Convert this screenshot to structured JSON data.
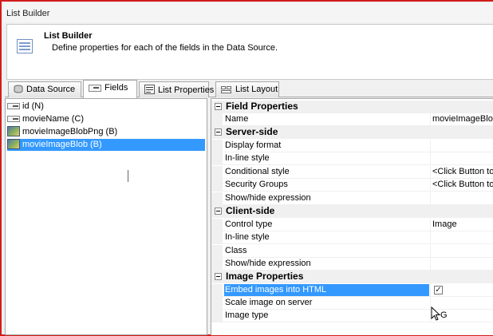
{
  "window": {
    "title": "List Builder"
  },
  "header": {
    "title": "List Builder",
    "description": "Define properties for each of the fields in the Data Source."
  },
  "tabs": [
    {
      "label": "Data Source",
      "icon": "database-icon"
    },
    {
      "label": "Fields",
      "icon": "field-icon",
      "active": true
    },
    {
      "label": "List Properties",
      "icon": "properties-icon"
    },
    {
      "label": "List Layout",
      "icon": "layout-icon"
    }
  ],
  "fields": [
    {
      "label": "id (N)",
      "icon": "text-field-icon"
    },
    {
      "label": "movieName (C)",
      "icon": "text-field-icon"
    },
    {
      "label": "movieImageBlobPng (B)",
      "icon": "image-field-icon"
    },
    {
      "label": "movieImageBlob (B)",
      "icon": "image-field-icon",
      "selected": true
    }
  ],
  "properties": {
    "field_properties": {
      "label": "Field Properties",
      "rows": [
        {
          "name": "Name",
          "value": "movieImageBlob"
        }
      ]
    },
    "server_side": {
      "label": "Server-side",
      "rows": [
        {
          "name": "Display format",
          "value": ""
        },
        {
          "name": "In-line style",
          "value": ""
        },
        {
          "name": "Conditional style",
          "value": "<Click Button to"
        },
        {
          "name": "Security Groups",
          "value": "<Click Button to"
        },
        {
          "name": "Show/hide expression",
          "value": ""
        }
      ]
    },
    "client_side": {
      "label": "Client-side",
      "rows": [
        {
          "name": "Control type",
          "value": "Image"
        },
        {
          "name": "In-line style",
          "value": ""
        },
        {
          "name": "Class",
          "value": ""
        },
        {
          "name": "Show/hide expression",
          "value": ""
        }
      ]
    },
    "image_properties": {
      "label": "Image Properties",
      "rows": [
        {
          "name": "Embed images into HTML",
          "value": "",
          "checked": true,
          "selected": true
        },
        {
          "name": "Scale image on server",
          "value": ""
        },
        {
          "name": "Image type",
          "value": "G"
        }
      ]
    }
  },
  "colors": {
    "accent": "#3399ff",
    "frame_border": "#d21c1c"
  }
}
